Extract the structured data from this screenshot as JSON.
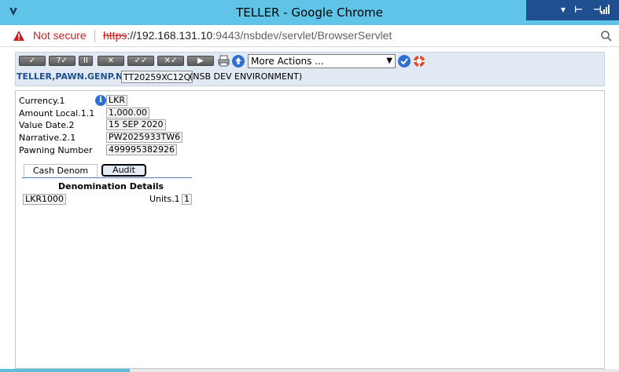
{
  "window": {
    "title": "TELLER - Google Chrome"
  },
  "address_bar": {
    "security_label": "Not secure",
    "url_scheme": "https",
    "url_host": "://192.168.131.10",
    "url_rest": ":9443/nsbdev/servlet/BrowserServlet"
  },
  "toolbar": {
    "buttons": [
      {
        "name": "commit-button",
        "glyph": "✓"
      },
      {
        "name": "validate-button",
        "glyph": "?✓"
      },
      {
        "name": "hold-button",
        "glyph": "II"
      },
      {
        "name": "delete-button",
        "glyph": "✕"
      },
      {
        "name": "authorise-button",
        "glyph": "✓✓"
      },
      {
        "name": "reverse-button",
        "glyph": "✕✓"
      },
      {
        "name": "next-button",
        "glyph": "▶"
      }
    ],
    "more_actions": "More Actions ...",
    "app_label": "TELLER,PAWN.GENP.NSB",
    "transaction_ref": "TT20259XC12Q",
    "environment": "(NSB DEV ENVIRONMENT)"
  },
  "form": {
    "fields": [
      {
        "label": "Currency.1",
        "value": "LKR"
      },
      {
        "label": "Amount Local.1.1",
        "value": "1,000.00"
      },
      {
        "label": "Value Date.2",
        "value": "15 SEP 2020"
      },
      {
        "label": "Narrative.2.1",
        "value": "PW2025933TW6"
      },
      {
        "label": "Pawning Number",
        "value": "499995382926"
      }
    ],
    "tabs": [
      {
        "label": "Cash Denom"
      },
      {
        "label": "Audit"
      }
    ],
    "denomination": {
      "title": "Denomination Details",
      "code": "LKR1000",
      "units_label": "Units.1",
      "units_value": "1"
    }
  },
  "colors": {
    "titlebar": "#5fc4e8",
    "toolbar_panel": "#e1e9f4",
    "app_label": "#1d4f91",
    "not_secure": "#c5221f"
  }
}
